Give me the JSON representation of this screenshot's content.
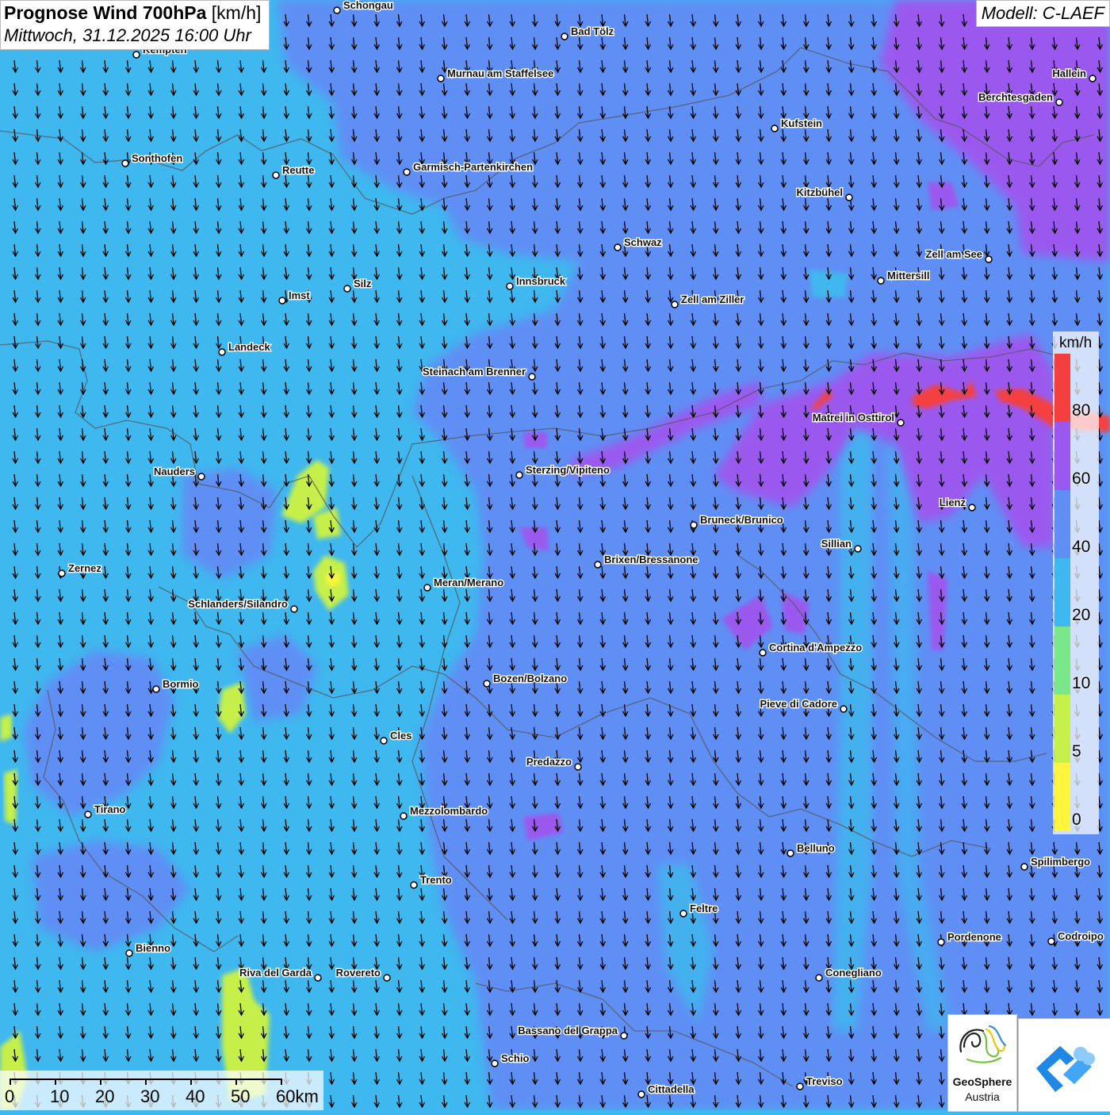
{
  "header": {
    "title_bold": "Prognose Wind 700hPa",
    "title_unit": "[km/h]",
    "datetime": "Mittwoch, 31.12.2025 16:00 Uhr",
    "model": "Modell: C-LAEF"
  },
  "legend": {
    "unit": "km/h",
    "bins": [
      {
        "label": "0",
        "color": "#fff53d"
      },
      {
        "label": "5",
        "color": "#c6f04a"
      },
      {
        "label": "10",
        "color": "#7ae88a"
      },
      {
        "label": "20",
        "color": "#3fb7ef"
      },
      {
        "label": "40",
        "color": "#5f8ff5"
      },
      {
        "label": "60",
        "color": "#9b58ee"
      },
      {
        "label": "80",
        "color": "#f43f3f"
      }
    ]
  },
  "scale": {
    "labels": [
      "0",
      "10",
      "20",
      "30",
      "40",
      "50",
      "60km"
    ]
  },
  "logos": {
    "geosphere_line1": "GeoSphere",
    "geosphere_line2": "Austria"
  },
  "cities": [
    {
      "name": "Schongau"
    },
    {
      "name": "Bad Tölz"
    },
    {
      "name": "Kempten"
    },
    {
      "name": "Murnau am Staffelsee"
    },
    {
      "name": "Hallein"
    },
    {
      "name": "Berchtesgaden"
    },
    {
      "name": "Kufstein"
    },
    {
      "name": "Sonthofen"
    },
    {
      "name": "Reutte"
    },
    {
      "name": "Garmisch-Partenkirchen"
    },
    {
      "name": "Kitzbühel"
    },
    {
      "name": "Schwaz"
    },
    {
      "name": "Zell am See"
    },
    {
      "name": "Mittersill"
    },
    {
      "name": "Innsbruck"
    },
    {
      "name": "Silz"
    },
    {
      "name": "Imst"
    },
    {
      "name": "Zell am Ziller"
    },
    {
      "name": "Landeck"
    },
    {
      "name": "Steinach am Brenner"
    },
    {
      "name": "Matrei in Osttirol"
    },
    {
      "name": "Nauders"
    },
    {
      "name": "Sterzing/Vipiteno"
    },
    {
      "name": "Lienz"
    },
    {
      "name": "Bruneck/Brunico"
    },
    {
      "name": "Sillian"
    },
    {
      "name": "Zernez"
    },
    {
      "name": "Brixen/Bressanone"
    },
    {
      "name": "Meran/Merano"
    },
    {
      "name": "Schlanders/Silandro"
    },
    {
      "name": "Cortina d'Ampezzo"
    },
    {
      "name": "Bozen/Bolzano"
    },
    {
      "name": "Bormio"
    },
    {
      "name": "Pieve di Cadore"
    },
    {
      "name": "Cles"
    },
    {
      "name": "Predazzo"
    },
    {
      "name": "Tirano"
    },
    {
      "name": "Mezzolombardo"
    },
    {
      "name": "Belluno"
    },
    {
      "name": "Spilimbergo"
    },
    {
      "name": "Trento"
    },
    {
      "name": "Feltre"
    },
    {
      "name": "Pordenone"
    },
    {
      "name": "Codroipo"
    },
    {
      "name": "Bienno"
    },
    {
      "name": "Riva del Garda"
    },
    {
      "name": "Rovereto"
    },
    {
      "name": "Conegliano"
    },
    {
      "name": "Bassano del Grappa"
    },
    {
      "name": "Schio"
    },
    {
      "name": "Treviso"
    },
    {
      "name": "Cittadella"
    }
  ]
}
